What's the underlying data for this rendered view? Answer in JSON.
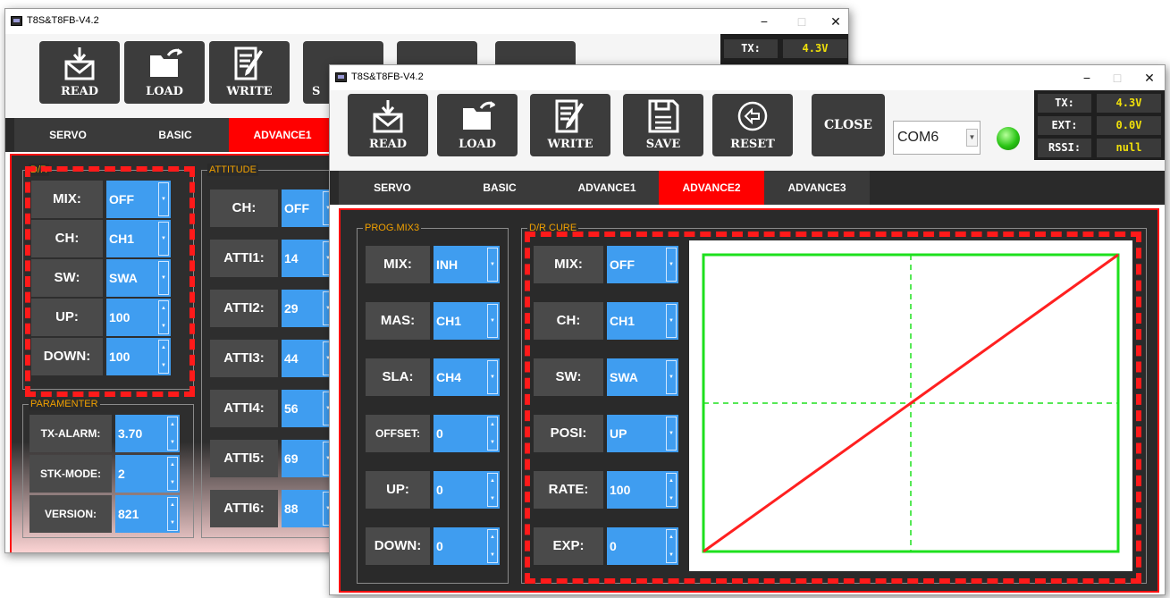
{
  "window_title": "T8S&T8FB-V4.2",
  "window_controls": {
    "min": "−",
    "max": "□",
    "close": "✕"
  },
  "toolbar": {
    "read": "READ",
    "load": "LOAD",
    "write": "WRITE",
    "save": "SAVE",
    "reset": "RESET",
    "close": "CLOSE",
    "com_port": "COM6",
    "partial_save": "S"
  },
  "status": {
    "tx_label": "TX:",
    "tx_value": "4.3V",
    "ext_label": "EXT:",
    "ext_value": "0.0V",
    "rssi_label": "RSSI:",
    "rssi_value": "null"
  },
  "tabs": [
    "SERVO",
    "BASIC",
    "ADVANCE1",
    "ADVANCE2",
    "ADVANCE3"
  ],
  "back": {
    "active_tab": "ADVANCE1",
    "dr_title": "D/R",
    "dr_rows": [
      {
        "label": "MIX:",
        "value": "OFF",
        "control": "dropdown"
      },
      {
        "label": "CH:",
        "value": "CH1",
        "control": "dropdown"
      },
      {
        "label": "SW:",
        "value": "SWA",
        "control": "dropdown"
      },
      {
        "label": "UP:",
        "value": "100",
        "control": "spin"
      },
      {
        "label": "DOWN:",
        "value": "100",
        "control": "spin"
      }
    ],
    "param_title": "PARAMENTER",
    "param_rows": [
      {
        "label": "TX-ALARM:",
        "value": "3.70"
      },
      {
        "label": "STK-MODE:",
        "value": "2"
      },
      {
        "label": "VERSION:",
        "value": "821"
      }
    ],
    "attitude_title": "ATTITUDE",
    "attitude_rows": [
      {
        "label": "CH:",
        "value": "OFF"
      },
      {
        "label": "ATTI1:",
        "value": "14"
      },
      {
        "label": "ATTI2:",
        "value": "29"
      },
      {
        "label": "ATTI3:",
        "value": "44"
      },
      {
        "label": "ATTI4:",
        "value": "56"
      },
      {
        "label": "ATTI5:",
        "value": "69"
      },
      {
        "label": "ATTI6:",
        "value": "88"
      }
    ]
  },
  "front": {
    "active_tab": "ADVANCE2",
    "prog_title": "PROG.MIX3",
    "prog_rows": [
      {
        "label": "MIX:",
        "value": "INH",
        "control": "dropdown"
      },
      {
        "label": "MAS:",
        "value": "CH1",
        "control": "dropdown"
      },
      {
        "label": "SLA:",
        "value": "CH4",
        "control": "dropdown"
      },
      {
        "label": "OFFSET:",
        "value": "0",
        "control": "spin"
      },
      {
        "label": "UP:",
        "value": "0",
        "control": "spin"
      },
      {
        "label": "DOWN:",
        "value": "0",
        "control": "spin"
      }
    ],
    "dr_title": "D/R CURE",
    "dr_rows": [
      {
        "label": "MIX:",
        "value": "OFF",
        "control": "dropdown"
      },
      {
        "label": "CH:",
        "value": "CH1",
        "control": "dropdown"
      },
      {
        "label": "SW:",
        "value": "SWA",
        "control": "dropdown"
      },
      {
        "label": "POSI:",
        "value": "UP",
        "control": "dropdown"
      },
      {
        "label": "RATE:",
        "value": "100",
        "control": "spin"
      },
      {
        "label": "EXP:",
        "value": "0",
        "control": "spin"
      }
    ]
  },
  "chart_data": {
    "type": "line",
    "series": [
      {
        "x": [
          0,
          1
        ],
        "y": [
          0,
          1
        ]
      }
    ],
    "xlim": [
      0,
      1
    ],
    "ylim": [
      0,
      1
    ],
    "grid": "center-crosshair",
    "colors": {
      "curve": "#ff2020",
      "frame": "#1ee01e",
      "crosshair": "#1ee01e"
    }
  },
  "colors": {
    "accent": "#ff0000",
    "value_bg": "#3f9df0",
    "status_value": "#f0e00a",
    "led": "#29c414"
  }
}
